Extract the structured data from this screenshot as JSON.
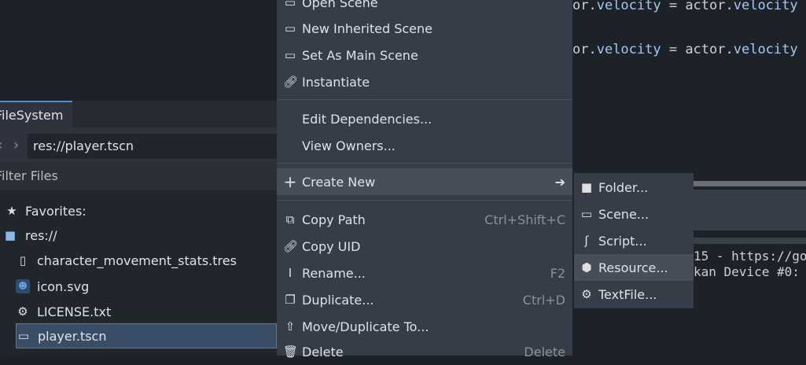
{
  "code": {
    "lines": [
      {
        "pre": "or.",
        "member": "velocity",
        "mid": " = actor.",
        "member2": "velocity"
      },
      {
        "pre": "or.",
        "member": "velocity",
        "mid": " = actor.",
        "member2": "velocity"
      }
    ]
  },
  "filesystem": {
    "tab_label": "FileSystem",
    "path": "res://player.tscn",
    "filter_placeholder": "Filter Files",
    "tree": [
      {
        "label": "Favorites:",
        "icon": "star-icon"
      },
      {
        "label": "res://",
        "icon": "folder-icon"
      },
      {
        "label": "character_movement_stats.tres",
        "icon": "file-icon"
      },
      {
        "label": "icon.svg",
        "icon": "godot-icon"
      },
      {
        "label": "LICENSE.txt",
        "icon": "textfile-icon"
      },
      {
        "label": "player.tscn",
        "icon": "scene-icon",
        "selected": true
      }
    ]
  },
  "context_menu": {
    "items": [
      {
        "label": "Open Scene",
        "icon": "scene-icon"
      },
      {
        "label": "New Inherited Scene",
        "icon": "new-scene-icon"
      },
      {
        "label": "Set As Main Scene",
        "icon": "scene-icon"
      },
      {
        "label": "Instantiate",
        "icon": "link-icon"
      },
      {
        "label": "Edit Dependencies..."
      },
      {
        "label": "View Owners..."
      },
      {
        "label": "Create New",
        "icon": "plus-icon"
      },
      {
        "label": "Copy Path",
        "icon": "copy-icon",
        "shortcut": "Ctrl+Shift+C"
      },
      {
        "label": "Copy UID",
        "icon": "link-icon"
      },
      {
        "label": "Rename...",
        "icon": "rename-icon",
        "shortcut": "F2"
      },
      {
        "label": "Duplicate...",
        "icon": "duplicate-icon",
        "shortcut": "Ctrl+D"
      },
      {
        "label": "Move/Duplicate To...",
        "icon": "move-icon"
      },
      {
        "label": "Delete",
        "icon": "trash-icon",
        "shortcut": "Delete"
      }
    ]
  },
  "submenu": {
    "items": [
      {
        "label": "Folder...",
        "icon": "folder-icon"
      },
      {
        "label": "Scene...",
        "icon": "scene-icon"
      },
      {
        "label": "Script...",
        "icon": "script-icon"
      },
      {
        "label": "Resource...",
        "icon": "resource-icon"
      },
      {
        "label": "TextFile...",
        "icon": "textfile-icon"
      }
    ]
  },
  "console": {
    "lines": [
      "15 - https://go",
      "kan Device #0:"
    ]
  }
}
